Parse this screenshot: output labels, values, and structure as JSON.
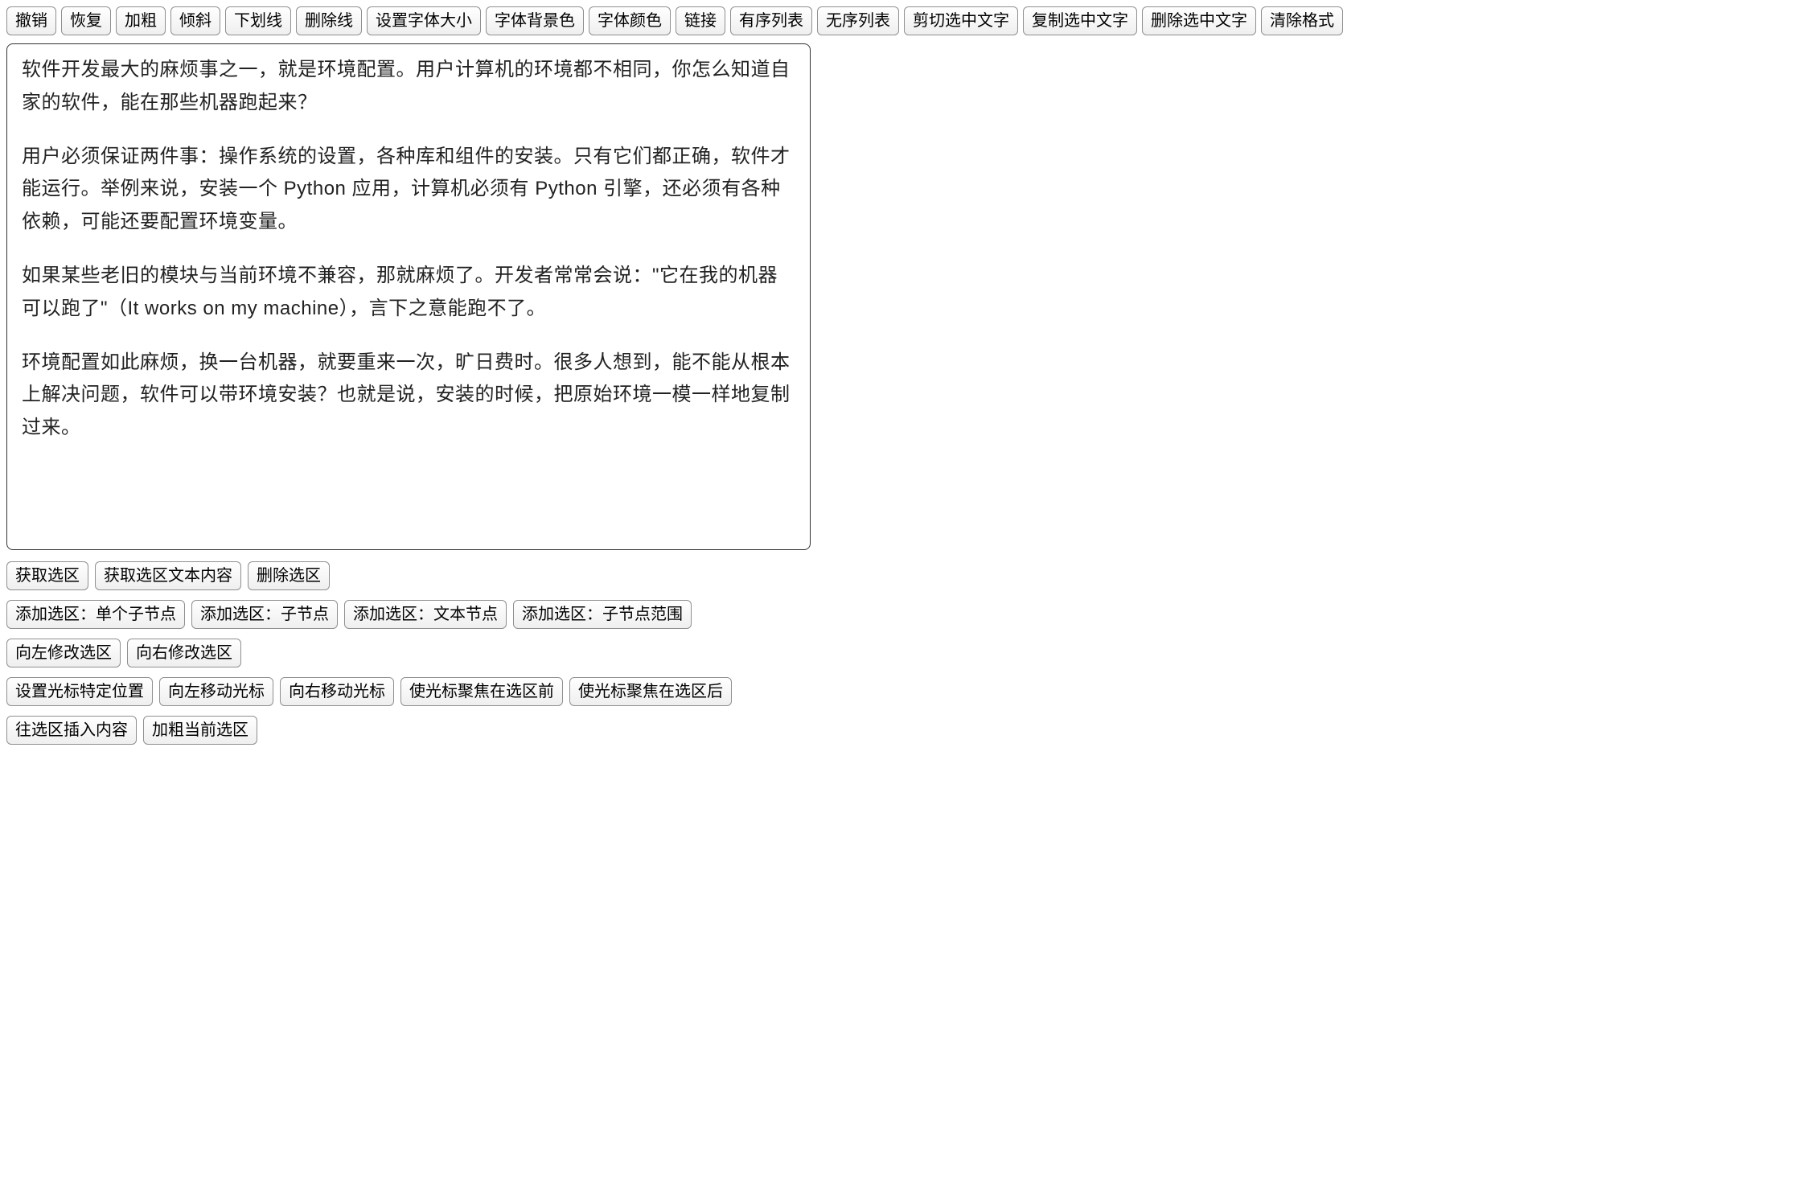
{
  "toolbar": {
    "undo": "撤销",
    "redo": "恢复",
    "bold": "加粗",
    "italic": "倾斜",
    "underline": "下划线",
    "strike": "删除线",
    "fontsize": "设置字体大小",
    "bgcolor": "字体背景色",
    "fontcolor": "字体颜色",
    "link": "链接",
    "ol": "有序列表",
    "ul": "无序列表",
    "cut_sel": "剪切选中文字",
    "copy_sel": "复制选中文字",
    "delete_sel": "删除选中文字",
    "clear_fmt": "清除格式"
  },
  "editor": {
    "p1": "软件开发最大的麻烦事之一，就是环境配置。用户计算机的环境都不相同，你怎么知道自家的软件，能在那些机器跑起来？",
    "p2": "用户必须保证两件事：操作系统的设置，各种库和组件的安装。只有它们都正确，软件才能运行。举例来说，安装一个 Python 应用，计算机必须有 Python 引擎，还必须有各种依赖，可能还要配置环境变量。",
    "p3": "如果某些老旧的模块与当前环境不兼容，那就麻烦了。开发者常常会说：\"它在我的机器可以跑了\"（It works on my machine），言下之意能跑不了。",
    "p4": "环境配置如此麻烦，换一台机器，就要重来一次，旷日费时。很多人想到，能不能从根本上解决问题，软件可以带环境安装？也就是说，安装的时候，把原始环境一模一样地复制过来。"
  },
  "actions": {
    "row1": {
      "get_sel": "获取选区",
      "get_sel_text": "获取选区文本内容",
      "del_sel": "删除选区"
    },
    "row2": {
      "add_sel_single_child": "添加选区：单个子节点",
      "add_sel_child": "添加选区：子节点",
      "add_sel_text": "添加选区：文本节点",
      "add_sel_child_range": "添加选区：子节点范围"
    },
    "row3": {
      "modify_left": "向左修改选区",
      "modify_right": "向右修改选区"
    },
    "row4": {
      "set_cursor_pos": "设置光标特定位置",
      "move_cursor_left": "向左移动光标",
      "move_cursor_right": "向右移动光标",
      "focus_before_sel": "使光标聚焦在选区前",
      "focus_after_sel": "使光标聚焦在选区后"
    },
    "row5": {
      "insert_to_sel": "往选区插入内容",
      "bold_cur_sel": "加粗当前选区"
    }
  }
}
